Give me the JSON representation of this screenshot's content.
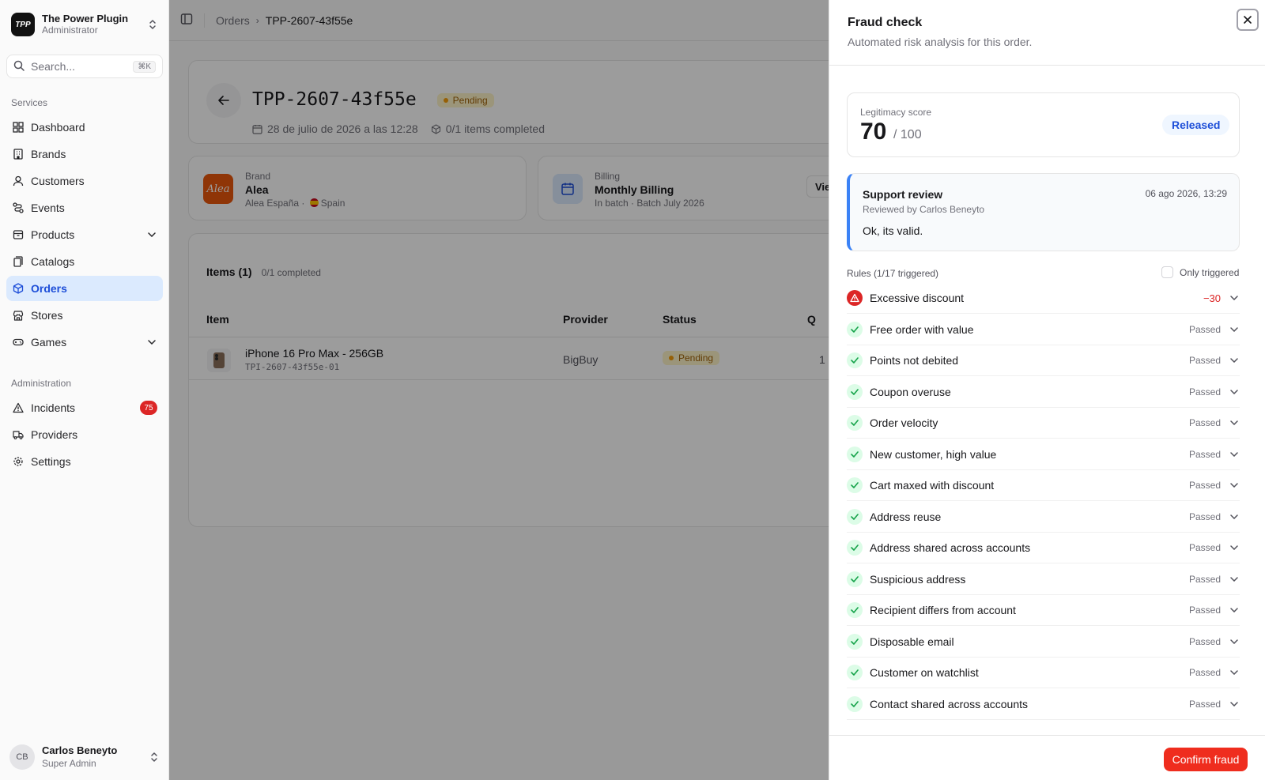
{
  "colors": {
    "accent": "#1d4ed8",
    "danger": "#dc2626",
    "pending": "#f59e0b",
    "pass": "#16a34a"
  },
  "org": {
    "logo": "TPP",
    "name": "The Power Plugin",
    "role": "Administrator"
  },
  "search": {
    "placeholder": "Search...",
    "shortcut": "⌘K"
  },
  "sidebar": {
    "services_label": "Services",
    "services": [
      {
        "label": "Dashboard",
        "icon": "grid-icon"
      },
      {
        "label": "Brands",
        "icon": "building-icon"
      },
      {
        "label": "Customers",
        "icon": "user-icon"
      },
      {
        "label": "Events",
        "icon": "route-icon"
      },
      {
        "label": "Products",
        "icon": "box-icon"
      },
      {
        "label": "Catalogs",
        "icon": "book-icon"
      },
      {
        "label": "Orders",
        "icon": "package-icon"
      },
      {
        "label": "Stores",
        "icon": "store-icon"
      },
      {
        "label": "Games",
        "icon": "gamepad-icon"
      }
    ],
    "admin_label": "Administration",
    "admin": [
      {
        "label": "Incidents",
        "icon": "alert-icon",
        "badge": "75"
      },
      {
        "label": "Providers",
        "icon": "truck-icon"
      },
      {
        "label": "Settings",
        "icon": "gear-icon"
      }
    ]
  },
  "user": {
    "initials": "CB",
    "name": "Carlos Beneyto",
    "role": "Super Admin"
  },
  "breadcrumb": {
    "parent": "Orders",
    "current": "TPP-2607-43f55e"
  },
  "order": {
    "id": "TPP-2607-43f55e",
    "status": "Pending",
    "date": "28 de julio de 2026 a las 12:28",
    "items_completed": "0/1 items completed"
  },
  "brand": {
    "label": "Brand",
    "logo": "Alea",
    "name": "Alea",
    "store": "Alea España",
    "country": "Spain"
  },
  "billing": {
    "label": "Billing",
    "name": "Monthly Billing",
    "detail": "In batch · Batch July 2026",
    "view_btn": "Vie"
  },
  "items": {
    "title": "Items (1)",
    "completed": "0/1 completed",
    "headers": {
      "item": "Item",
      "provider": "Provider",
      "status": "Status",
      "qty": "Q"
    },
    "rows": [
      {
        "name": "iPhone 16 Pro Max - 256GB",
        "sku": "TPI-2607-43f55e-01",
        "provider": "BigBuy",
        "status": "Pending",
        "qty": "1"
      }
    ]
  },
  "fraud": {
    "title": "Fraud check",
    "subtitle": "Automated risk analysis for this order.",
    "score_label": "Legitimacy score",
    "score": "70",
    "score_max": "/ 100",
    "score_value": 70,
    "decision": "Released",
    "review": {
      "title": "Support review",
      "by": "Reviewed by Carlos Beneyto",
      "date": "06 ago 2026, 13:29",
      "text": "Ok, its valid."
    },
    "rules_label": "Rules (1/17 triggered)",
    "only_triggered": "Only triggered",
    "rules": [
      {
        "name": "Excessive discount",
        "status": "−30",
        "triggered": true
      },
      {
        "name": "Free order with value",
        "status": "Passed",
        "triggered": false
      },
      {
        "name": "Points not debited",
        "status": "Passed",
        "triggered": false
      },
      {
        "name": "Coupon overuse",
        "status": "Passed",
        "triggered": false
      },
      {
        "name": "Order velocity",
        "status": "Passed",
        "triggered": false
      },
      {
        "name": "New customer, high value",
        "status": "Passed",
        "triggered": false
      },
      {
        "name": "Cart maxed with discount",
        "status": "Passed",
        "triggered": false
      },
      {
        "name": "Address reuse",
        "status": "Passed",
        "triggered": false
      },
      {
        "name": "Address shared across accounts",
        "status": "Passed",
        "triggered": false
      },
      {
        "name": "Suspicious address",
        "status": "Passed",
        "triggered": false
      },
      {
        "name": "Recipient differs from account",
        "status": "Passed",
        "triggered": false
      },
      {
        "name": "Disposable email",
        "status": "Passed",
        "triggered": false
      },
      {
        "name": "Customer on watchlist",
        "status": "Passed",
        "triggered": false
      },
      {
        "name": "Contact shared across accounts",
        "status": "Passed",
        "triggered": false
      }
    ],
    "confirm_btn": "Confirm fraud"
  }
}
